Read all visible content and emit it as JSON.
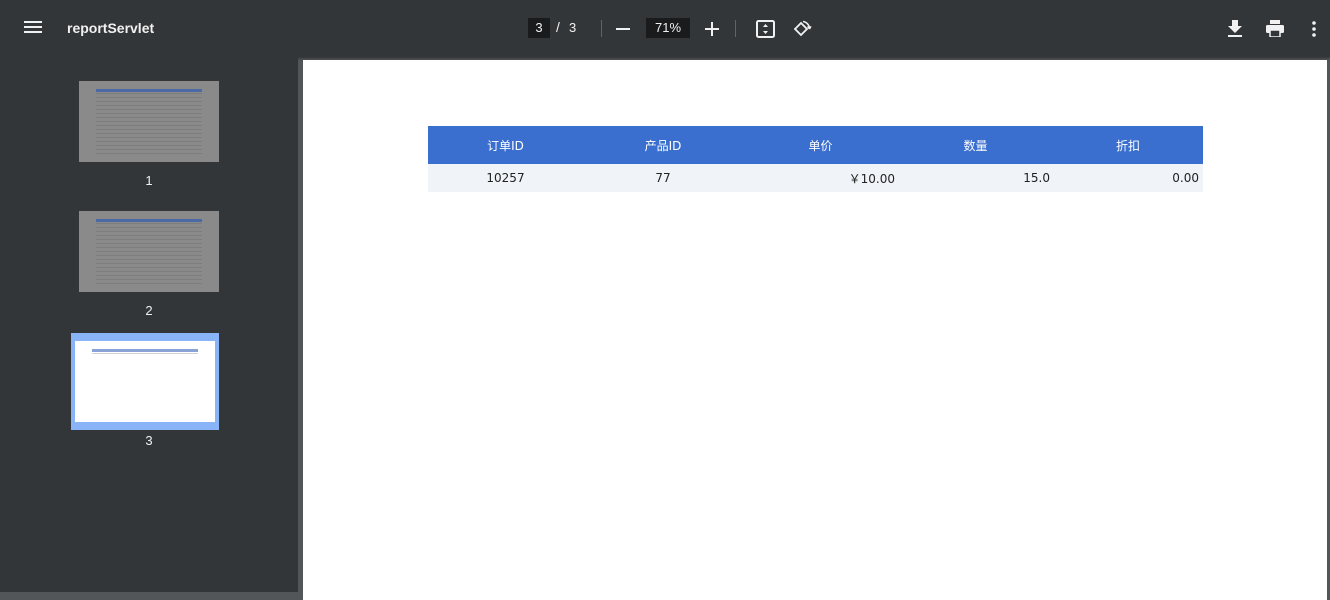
{
  "toolbar": {
    "title": "reportServlet",
    "current_page": "3",
    "separator": "/",
    "total_pages": "3",
    "zoom": "71%",
    "icons": [
      "menu-icon",
      "zoom-out-icon",
      "zoom-in-icon",
      "fit-page-icon",
      "rotate-icon",
      "download-icon",
      "print-icon",
      "more-icon"
    ]
  },
  "sidebar": {
    "thumbnails": [
      {
        "label": "1",
        "selected": false
      },
      {
        "label": "2",
        "selected": false
      },
      {
        "label": "3",
        "selected": true
      }
    ]
  },
  "report": {
    "headers": [
      "订单ID",
      "产品ID",
      "单价",
      "数量",
      "折扣"
    ],
    "rows": [
      [
        "10257",
        "77",
        "￥10.00",
        "15.0",
        "0.00"
      ]
    ]
  },
  "colors": {
    "toolbar_bg": "#323639",
    "viewer_bg": "#525659",
    "header_blue": "#3a6fcf",
    "row_bg": "#f0f3f7",
    "selected_thumb_border": "#8ab4f8"
  }
}
